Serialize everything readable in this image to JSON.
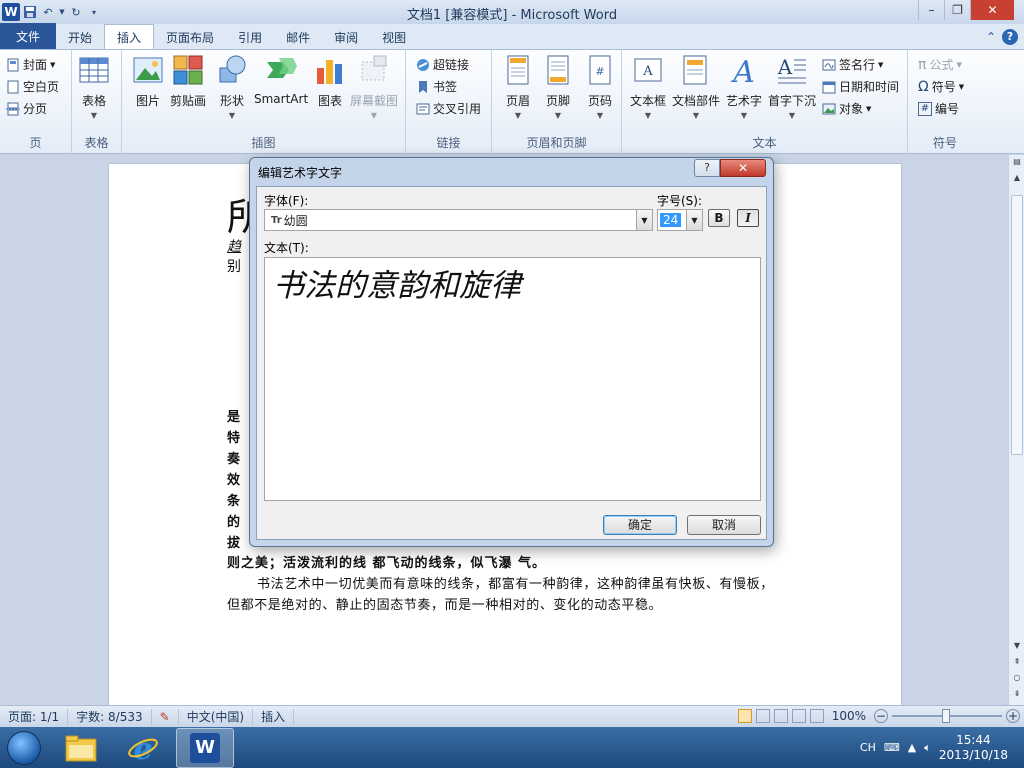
{
  "window": {
    "title": "文档1 [兼容模式] - Microsoft Word",
    "minimize": "–",
    "maximize": "❐",
    "close": "✕"
  },
  "tabs": {
    "file": "文件",
    "items": [
      "开始",
      "插入",
      "页面布局",
      "引用",
      "邮件",
      "审阅",
      "视图"
    ],
    "active": "插入"
  },
  "ribbon": {
    "pages": {
      "label": "页",
      "cover": "封面",
      "blank": "空白页",
      "break": "分页"
    },
    "tables": {
      "label": "表格",
      "table": "表格"
    },
    "illustrations": {
      "label": "插图",
      "picture": "图片",
      "clipart": "剪贴画",
      "shapes": "形状",
      "smartart": "SmartArt",
      "chart": "图表",
      "screenshot": "屏幕截图"
    },
    "links": {
      "label": "链接",
      "hyperlink": "超链接",
      "bookmark": "书签",
      "crossref": "交叉引用"
    },
    "header_footer": {
      "label": "页眉和页脚",
      "header": "页眉",
      "footer": "页脚",
      "page_number": "页码"
    },
    "text": {
      "label": "文本",
      "textbox": "文本框",
      "quickparts": "文档部件",
      "wordart": "艺术字",
      "dropcap": "首字下沉",
      "signature": "签名行",
      "datetime": "日期和时间",
      "object": "对象"
    },
    "symbols": {
      "label": "符号",
      "equation": "公式",
      "symbol": "符号",
      "number": "编号"
    }
  },
  "document": {
    "frag_left_1": "所",
    "frag_left_2": "趋",
    "frag_left_3": "别",
    "frag_right_1": "",
    "frag_right_2": "",
    "hidden_left_lines": [
      "是",
      "特",
      "奏",
      "效",
      "条",
      "的",
      "拔"
    ],
    "line_partial": "则之美；活泼流利的线      都飞动的线条，似飞瀑      气。",
    "para_1": "书法艺术中一切优美而有意味的线条，都富有一种韵律，这种韵律虽有快板、有慢板，",
    "para_2": "但都不是绝对的、静止的固态节奏，而是一种相对的、变化的动态平稳。"
  },
  "dialog": {
    "title": "编辑艺术字文字",
    "help": "?",
    "close": "✕",
    "font_label": "字体(F):",
    "font_value": "幼圆",
    "font_icon_text": "Tr",
    "size_label": "字号(S):",
    "size_value": "24",
    "bold_label": "B",
    "italic_label": "I",
    "text_label": "文本(T):",
    "text_value": "书法的意韵和旋律",
    "ok": "确定",
    "cancel": "取消"
  },
  "statusbar": {
    "page": "页面: 1/1",
    "words": "字数: 8/533",
    "language": "中文(中国)",
    "mode": "插入",
    "zoom": "100%",
    "zoom_minus": "−",
    "zoom_plus": "+"
  },
  "taskbar": {
    "ime": "CH",
    "time": "15:44",
    "date": "2013/10/18"
  }
}
